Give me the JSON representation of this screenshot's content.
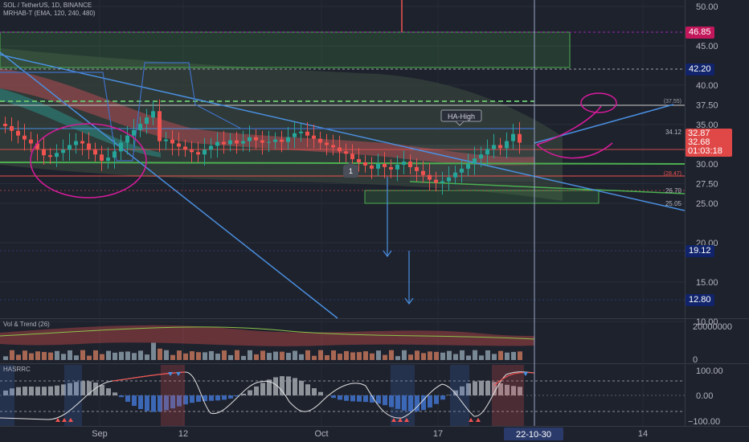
{
  "header": {
    "symbol_line": "SOL / TetherUS, 1D, BINANCE",
    "indicator_line": "MRHAB-T (EMA, 120, 240, 480)"
  },
  "annotations": {
    "ha_high": "HA-High",
    "marker_1": "1"
  },
  "price_scale": {
    "ticks": [
      "50.00",
      "45.00",
      "40.00",
      "37.50",
      "35.00",
      "30.00",
      "27.50",
      "25.00",
      "20.00",
      "15.00",
      "10.00"
    ],
    "tick_values": [
      50,
      45,
      40,
      37.5,
      35,
      30,
      27.5,
      25,
      20,
      15,
      10
    ]
  },
  "price_labels": {
    "p4685": "46.85",
    "p4220": "42.20",
    "p1912": "19.12",
    "p1280": "12.80",
    "last": "32.87",
    "current": "32.68",
    "countdown": "01:03:18"
  },
  "level_labels": {
    "l3755": "(37.55)",
    "l3412": "34.12",
    "l2847": "(28.47)",
    "l2670": "26.70",
    "l2505": "25.05"
  },
  "volume_pane": {
    "title": "Vol & Trend (26)",
    "ticks": [
      "20000000",
      "0"
    ]
  },
  "osc_pane": {
    "title": "HASRRC",
    "ticks": [
      "100.00",
      "0.00",
      "−100.00"
    ]
  },
  "time_axis": {
    "labels": [
      "Sep",
      "12",
      "Oct",
      "17",
      "14"
    ],
    "cursor_label": "22-10-30"
  },
  "colors": {
    "background": "#1e222d",
    "up": "#26a69a",
    "down": "#ef5350",
    "trendline": "#4a8fdf",
    "zone": "#4caf50",
    "magenta": "#d81b9c",
    "price_badge": "#e04848",
    "level_badge": "#10236b"
  },
  "chart_data": {
    "type": "candlestick",
    "x_labels": [
      "Sep",
      "12",
      "Oct",
      "17",
      "14"
    ],
    "y_range": [
      9,
      52
    ],
    "current_price": 32.68,
    "last_price": 32.87,
    "levels": [
      46.85,
      42.2,
      37.55,
      34.12,
      28.47,
      26.7,
      25.05,
      19.12,
      12.8
    ],
    "close_series": [
      34.8,
      34.2,
      33.6,
      33.1,
      32.6,
      31.9,
      31.1,
      30.9,
      31.4,
      31.8,
      32.4,
      32.9,
      32.6,
      31.8,
      31.2,
      30.4,
      30.8,
      31.6,
      32.7,
      33.6,
      34.3,
      35.1,
      35.9,
      36.7,
      32.9,
      33.1,
      32.6,
      32.2,
      31.8,
      31.5,
      31.2,
      31.8,
      32.3,
      32.8,
      32.5,
      33.0,
      32.6,
      32.9,
      33.4,
      33.0,
      32.7,
      32.8,
      33.1,
      32.8,
      33.4,
      33.9,
      34.1,
      33.6,
      33.2,
      32.7,
      32.4,
      32.1,
      31.6,
      31.3,
      30.6,
      30.2,
      29.8,
      29.4,
      30.0,
      29.6,
      29.3,
      29.9,
      30.3,
      29.6,
      29.1,
      28.6,
      28.0,
      27.6,
      27.8,
      28.3,
      28.9,
      29.4,
      30.0,
      30.7,
      31.2,
      31.9,
      32.4,
      32.0,
      32.9,
      33.8,
      32.7
    ],
    "volume_max": 20000000,
    "oscillator_range": [
      -100,
      100
    ]
  }
}
